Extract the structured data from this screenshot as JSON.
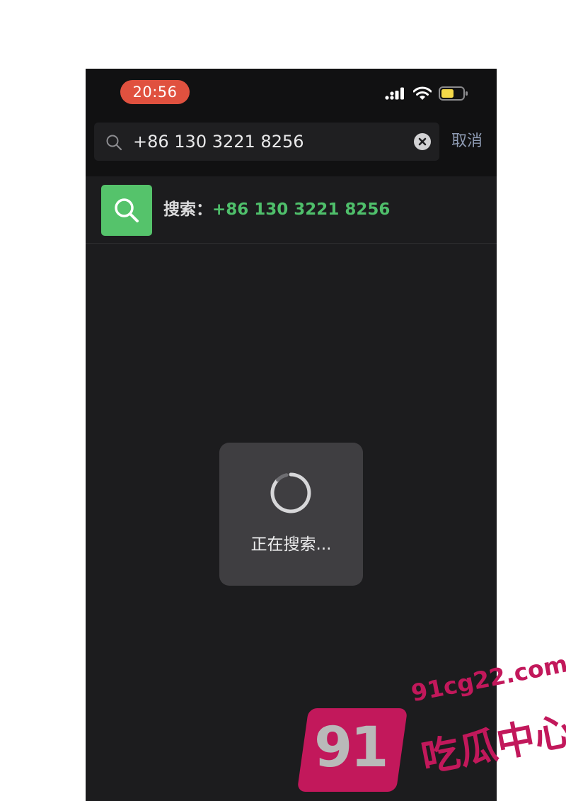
{
  "status_bar": {
    "time": "20:56",
    "icons": [
      "cellular-signal-icon",
      "wifi-icon",
      "battery-icon"
    ],
    "time_pill_color": "#e0513f",
    "battery_color": "#f5d949"
  },
  "search": {
    "query": "+86 130 3221 8256",
    "cancel_label": "取消",
    "icons": [
      "search-icon",
      "clear-icon"
    ]
  },
  "result": {
    "label": "搜索：",
    "query": "+86 130 3221 8256",
    "icon": "search-icon",
    "accent_color": "#4fbf6b"
  },
  "loading_toast": {
    "text": "正在搜索..."
  },
  "watermark": {
    "badge": "91",
    "url": "91cg22.com",
    "title": "吃瓜中心",
    "color": "#c2185b"
  }
}
